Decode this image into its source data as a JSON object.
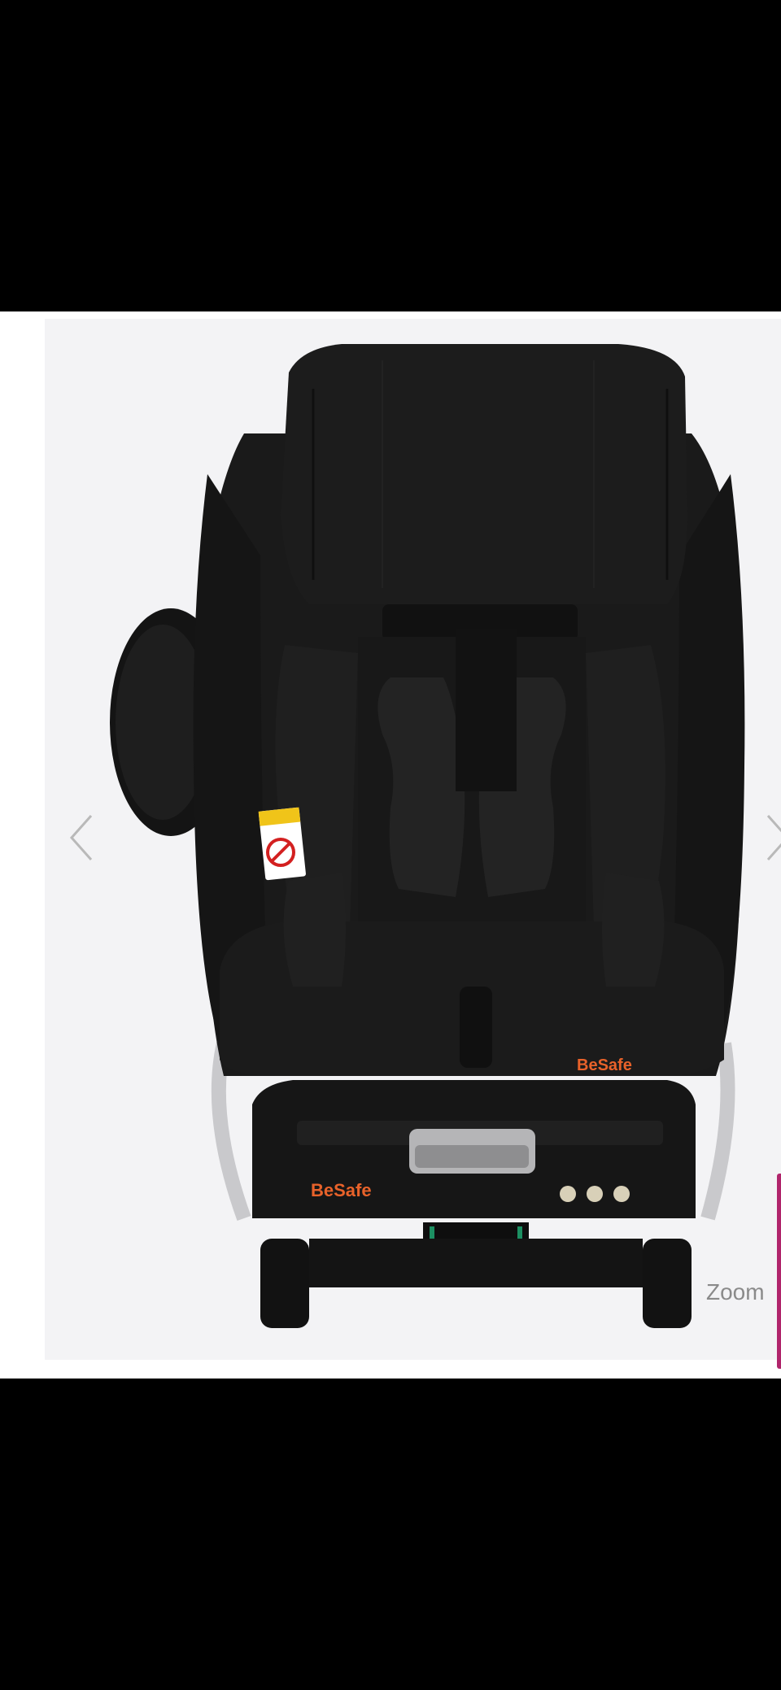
{
  "gallery": {
    "prev_icon": "chevron-left-icon",
    "next_icon": "chevron-right-icon",
    "zoom_label": "Zoom"
  },
  "product": {
    "brand_seat": "BeSafe",
    "brand_base": "BeSafe"
  },
  "colors": {
    "background": "#000000",
    "image_bg": "#f3f3f5",
    "accent_pink": "#b0246b",
    "brand_orange": "#e8622a"
  }
}
